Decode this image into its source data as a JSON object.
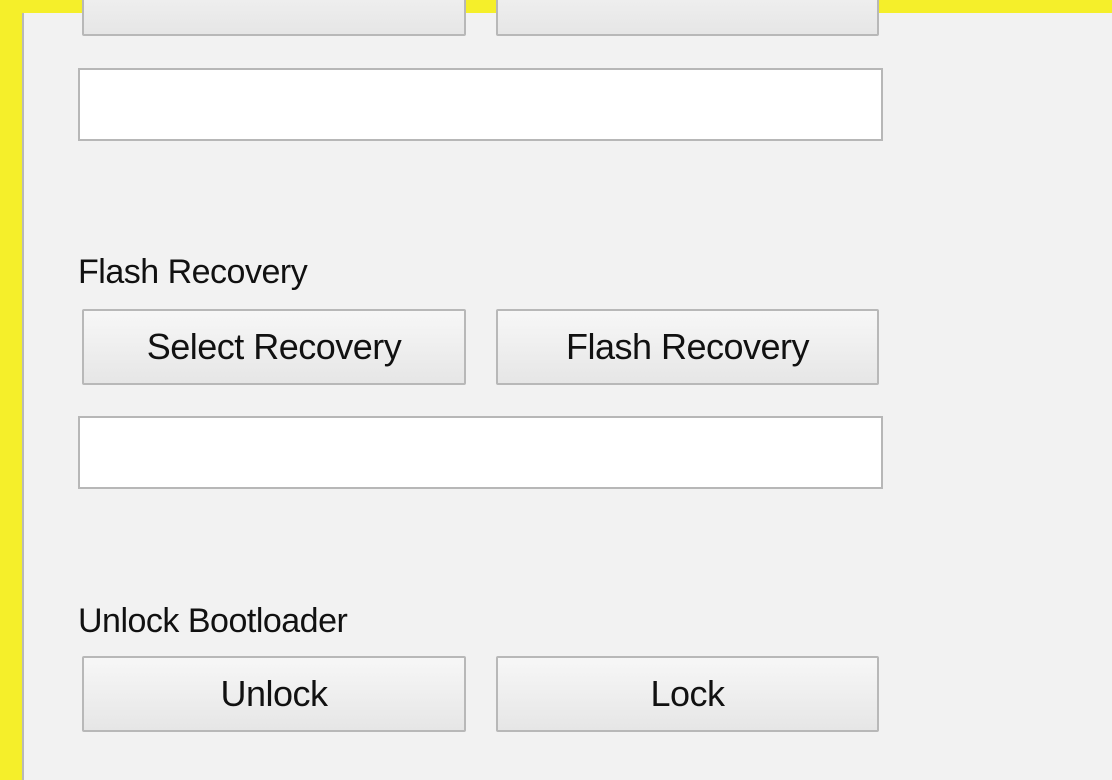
{
  "top_section": {
    "button_left_label": "",
    "button_right_label": "",
    "path_value": ""
  },
  "flash_recovery": {
    "label": "Flash Recovery",
    "select_button": "Select Recovery",
    "flash_button": "Flash Recovery",
    "path_value": ""
  },
  "unlock_bootloader": {
    "label": "Unlock Bootloader",
    "unlock_button": "Unlock",
    "lock_button": "Lock"
  }
}
